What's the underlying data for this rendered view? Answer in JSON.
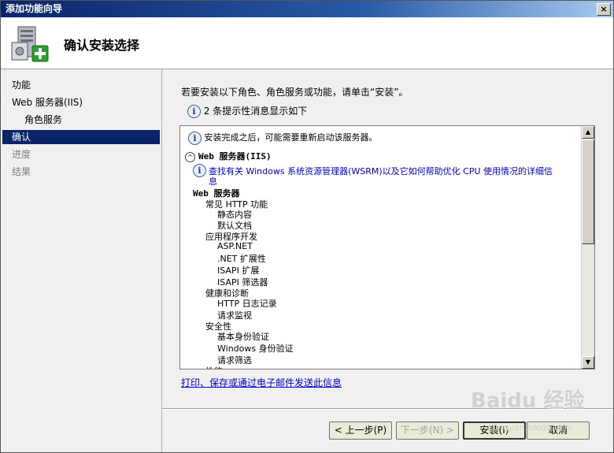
{
  "window": {
    "title": "添加功能向导",
    "close_label": "×"
  },
  "header": {
    "title": "确认安装选择"
  },
  "nav": {
    "items": [
      {
        "label": "功能",
        "state": "normal"
      },
      {
        "label": "Web 服务器(IIS)",
        "state": "normal"
      },
      {
        "label": "角色服务",
        "state": "sub"
      },
      {
        "label": "确认",
        "state": "selected"
      },
      {
        "label": "进度",
        "state": "disabled"
      },
      {
        "label": "结果",
        "state": "disabled"
      }
    ]
  },
  "content": {
    "intro": "若要安装以下角色、角色服务或功能，请单击“安装”。",
    "notice": "2 条提示性消息显示如下",
    "restart_msg": "安装完成之后，可能需要重新启动该服务器。",
    "section_title": "Web 服务器(IIS)",
    "info_link_line1": "查找有关 Windows 系统资源管理器(WSRM)以及它如何帮助优化 CPU 使用情况的详细信",
    "info_link_line2": "息",
    "tree": [
      "Web 服务器",
      "常见 HTTP 功能",
      "静态内容",
      "默认文档",
      "应用程序开发",
      "ASP.NET",
      ".NET 扩展性",
      "ISAPI 扩展",
      "ISAPI 筛选器",
      "健康和诊断",
      "HTTP 日志记录",
      "请求监视",
      "安全性",
      "基本身份验证",
      "Windows 身份验证",
      "请求筛选",
      "性能"
    ],
    "email_link": "打印、保存或通过电子邮件发送此信息"
  },
  "buttons": {
    "back": "< 上一步(P)",
    "next": "下一步(N) >",
    "install": "安装(I)",
    "cancel": "取消"
  },
  "watermark": {
    "text": "Baidu 经验",
    "sub": "jingyan.baidu.com"
  },
  "colors": {
    "selected_nav": "#0a246a",
    "link": "#0000cc",
    "titlebar": "#0a246a"
  }
}
